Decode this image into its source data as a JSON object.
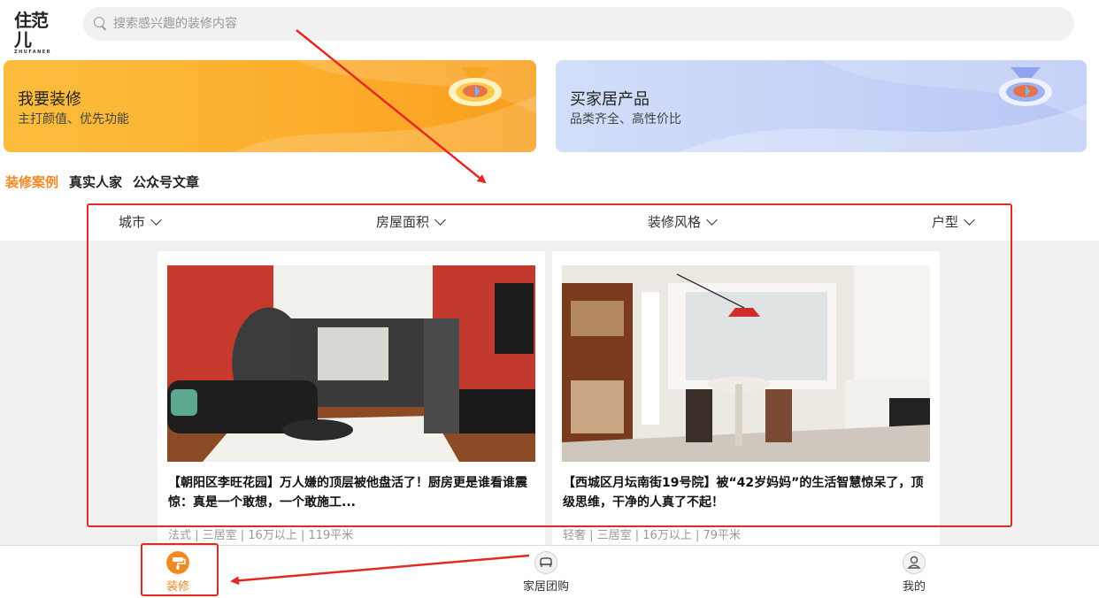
{
  "logo": {
    "main": "住范儿",
    "sub": "ZHUFANER"
  },
  "search": {
    "placeholder": "搜索感兴趣的装修内容"
  },
  "cards": [
    {
      "title": "我要装修",
      "subtitle": "主打颜值、优先功能"
    },
    {
      "title": "买家居产品",
      "subtitle": "品类齐全、高性价比"
    }
  ],
  "tabs": [
    "装修案例",
    "真实人家",
    "公众号文章"
  ],
  "filters": [
    "城市",
    "房屋面积",
    "装修风格",
    "户型"
  ],
  "cases": [
    {
      "title": "【朝阳区李旺花园】万人嫌的顶层被他盘活了！厨房更是谁看谁震惊：真是一个敢想，一个敢施工...",
      "meta": "法式 | 三居室 | 16万以上 | 119平米"
    },
    {
      "title": "【西城区月坛南街19号院】被“42岁妈妈”的生活智慧惊呆了，顶级思维，干净的人真了不起！",
      "meta": "轻奢 | 三居室 | 16万以上 | 79平米"
    }
  ],
  "bottom_nav": [
    {
      "label": "装修",
      "icon": "paint-roller-icon",
      "active": true
    },
    {
      "label": "家居团购",
      "icon": "sofa-icon",
      "active": false
    },
    {
      "label": "我的",
      "icon": "user-icon",
      "active": false
    }
  ],
  "colors": {
    "accent": "#f08a24",
    "annotation": "#e32a22",
    "card_left": "#fcad2c",
    "card_right": "#c3d1f7"
  }
}
